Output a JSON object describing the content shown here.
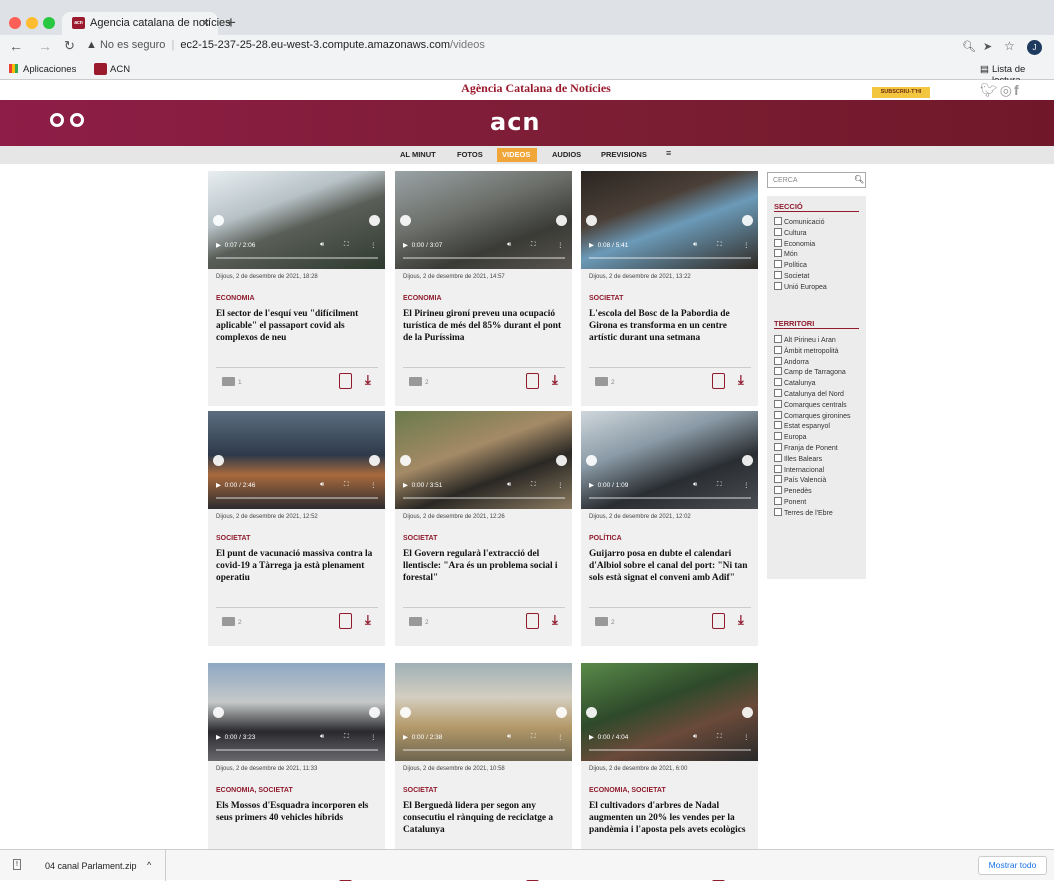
{
  "browser": {
    "tab_title": "Agencia catalana de notícies",
    "tab_close": "×",
    "new_tab": "+",
    "insecure": "No es seguro",
    "url_host": "ec2-15-237-25-28.eu-west-3.compute.amazonaws.com",
    "url_path": "/videos",
    "bookmarks": [
      "Aplicaciones",
      "ACN"
    ],
    "reading_list": "Lista de lectura",
    "profile_initial": "J"
  },
  "site": {
    "agency_name": "Agència Catalana de Notícies",
    "subscribe": "SUBSCRIU-T'HI",
    "logo": "acn",
    "menu": [
      "AL MINUT",
      "FOTOS",
      "VIDEOS",
      "AUDIOS",
      "PREVISIONS",
      "≡"
    ],
    "active_menu": "VIDEOS"
  },
  "cards": [
    {
      "date": "Dijous, 2 de desembre de 2021, 18:28",
      "section": "ECONOMIA",
      "title": "El sector de l'esquí veu \"difícilment aplicable\" el passaport covid als complexos de neu",
      "time": "0:07 / 2:06",
      "count": "1"
    },
    {
      "date": "Dijous, 2 de desembre de 2021, 14:57",
      "section": "ECONOMIA",
      "title": "El Pirineu gironí preveu una ocupació turística de més del 85% durant el pont de la Puríssima",
      "time": "0:00 / 3:07",
      "count": "2"
    },
    {
      "date": "Dijous, 2 de desembre de 2021, 13:22",
      "section": "SOCIETAT",
      "title": "L'escola del Bosc de la Pabordia de Girona es transforma en un centre artístic durant una setmana",
      "time": "0:08 / 5:41",
      "count": "2"
    },
    {
      "date": "Dijous, 2 de desembre de 2021, 12:52",
      "section": "SOCIETAT",
      "title": "El punt de vacunació massiva contra la covid-19 a Tàrrega ja està plenament operatiu",
      "time": "0:00 / 2:46",
      "count": "2"
    },
    {
      "date": "Dijous, 2 de desembre de 2021, 12:26",
      "section": "SOCIETAT",
      "title": "El Govern regularà l'extracció del llentiscle: \"Ara és un problema social i forestal\"",
      "time": "0:00 / 3:51",
      "count": "2"
    },
    {
      "date": "Dijous, 2 de desembre de 2021, 12:02",
      "section": "POLÍTICA",
      "title": "Guijarro posa en dubte el calendari d'Albiol sobre el canal del port: \"Ni tan sols està signat el conveni amb Adif\"",
      "time": "0:00 / 1:09",
      "count": "2"
    },
    {
      "date": "Dijous, 2 de desembre de 2021, 11:33",
      "section": "ECONOMIA, SOCIETAT",
      "title": "Els Mossos d'Esquadra incorporen els seus primers 40 vehicles híbrids",
      "time": "0:00 / 3:23",
      "count": "2"
    },
    {
      "date": "Dijous, 2 de desembre de 2021, 10:58",
      "section": "SOCIETAT",
      "title": "El Berguedà lidera per segon any consecutiu el rànquing de reciclatge a Catalunya",
      "time": "0:00 / 2:38",
      "count": "2"
    },
    {
      "date": "Dijous, 2 de desembre de 2021, 6:00",
      "section": "ECONOMIA, SOCIETAT",
      "title": "El cultivadors d'arbres de Nadal augmenten un 20% les vendes per la pandèmia i l'aposta pels avets ecològics",
      "time": "0:00 / 4:04",
      "count": "2"
    }
  ],
  "sidebar": {
    "search_placeholder": "CERCA",
    "seccio_title": "SECCIÓ",
    "seccio": [
      "Comunicació",
      "Cultura",
      "Economia",
      "Món",
      "Política",
      "Societat",
      "Unió Europea"
    ],
    "territori_title": "TERRITORI",
    "territori": [
      "Alt Pirineu i Aran",
      "Àmbit metropolità",
      "Andorra",
      "Camp de Tarragona",
      "Catalunya",
      "Catalunya del Nord",
      "Comarques centrals",
      "Comarques gironines",
      "Estat espanyol",
      "Europa",
      "Franja de Ponent",
      "Illes Balears",
      "Internacional",
      "País Valencià",
      "Penedès",
      "Ponent",
      "Terres de l'Ebre"
    ]
  },
  "downloads": {
    "file": "04 canal Parlament.zip",
    "show_all": "Mostrar todo"
  },
  "colors": {
    "brand": "#8f1b2d",
    "accent": "#f0a638",
    "band": "#7b1d33"
  }
}
